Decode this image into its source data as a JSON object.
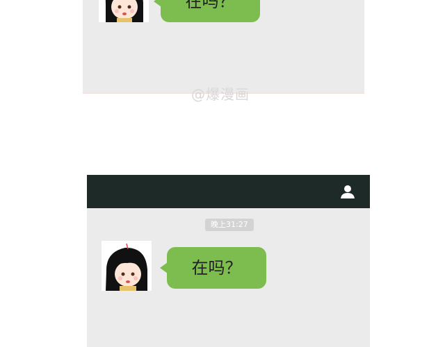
{
  "top_panel": {
    "message": "在吗？"
  },
  "watermark": "@爆漫画",
  "bottom_panel": {
    "header_icon": "contact-icon",
    "timestamp": "晚上31:27",
    "message": "在吗？"
  },
  "colors": {
    "header_bg": "#1e2a28",
    "chat_bg": "#ebebeb",
    "bubble_green": "#7dbd4f",
    "timestamp_bg": "#d3d3d3"
  }
}
